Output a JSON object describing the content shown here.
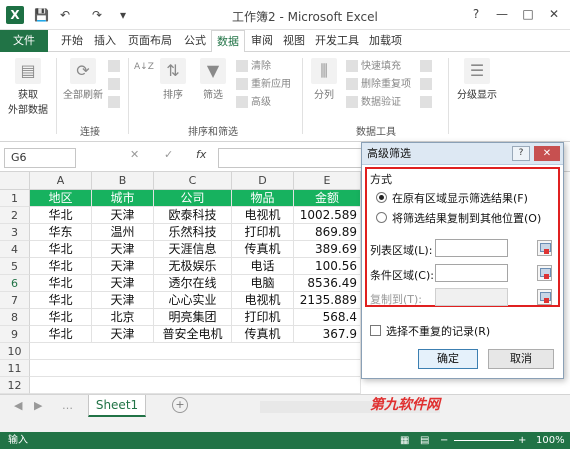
{
  "window": {
    "title": "工作簿2 - Microsoft Excel",
    "logo": "X",
    "help": "?",
    "min": "—",
    "max": "□",
    "close": "✕"
  },
  "quick_access": {
    "save_icon": "💾",
    "undo": "↶",
    "redo": "↷",
    "more": "▾"
  },
  "tabs": [
    {
      "label": "文件"
    },
    {
      "label": "开始"
    },
    {
      "label": "插入"
    },
    {
      "label": "页面布局"
    },
    {
      "label": "公式"
    },
    {
      "label": "数据"
    },
    {
      "label": "审阅"
    },
    {
      "label": "视图"
    },
    {
      "label": "开发工具"
    },
    {
      "label": "加载项"
    }
  ],
  "ribbon": {
    "get_external": "获取\n外部数据",
    "refresh_all": "全部刷新",
    "connections_group": "连接",
    "sort_az": "A↓Z",
    "sort": "排序",
    "filter": "筛选",
    "clear": "清除",
    "reapply": "重新应用",
    "advanced": "高级",
    "sort_filter_group": "排序和筛选",
    "split": "分列",
    "flash_fill": "快速填充",
    "remove_dup": "删除重复项",
    "validation": "数据验证",
    "data_tools_group": "数据工具",
    "outline": "分级显示"
  },
  "formula_bar": {
    "name_box": "G6",
    "cancel": "✕",
    "enter": "✓",
    "fx": "fx"
  },
  "columns": [
    "A",
    "B",
    "C",
    "D",
    "E"
  ],
  "rows": [
    "1",
    "2",
    "3",
    "4",
    "5",
    "6",
    "7",
    "8",
    "9",
    "10",
    "11",
    "12"
  ],
  "table": {
    "header": [
      "地区",
      "城市",
      "公司",
      "物品",
      "金额"
    ],
    "data": [
      [
        "华北",
        "天津",
        "欧泰科技",
        "电视机",
        "1002.589"
      ],
      [
        "华东",
        "温州",
        "乐然科技",
        "打印机",
        "869.89"
      ],
      [
        "华北",
        "天津",
        "天涯信息",
        "传真机",
        "389.69"
      ],
      [
        "华北",
        "天津",
        "无极娱乐",
        "电话",
        "100.56"
      ],
      [
        "华北",
        "天津",
        "透尔在线",
        "电脑",
        "8536.49"
      ],
      [
        "华北",
        "天津",
        "心心实业",
        "电视机",
        "2135.889"
      ],
      [
        "华北",
        "北京",
        "明亮集团",
        "打印机",
        "568.4"
      ],
      [
        "华北",
        "天津",
        "普安全电机",
        "传真机",
        "367.9"
      ]
    ]
  },
  "sheet_tab": "Sheet1",
  "status": {
    "mode": "输入",
    "zoom": "100%"
  },
  "dialog": {
    "title": "高级筛选",
    "method": "方式",
    "opt1": "在原有区域显示筛选结果(F)",
    "opt2": "将筛选结果复制到其他位置(O)",
    "list_range": "列表区域(L):",
    "criteria_range": "条件区域(C):",
    "copy_to": "复制到(T):",
    "unique": "选择不重复的记录(R)",
    "ok": "确定",
    "cancel": "取消",
    "help": "?",
    "close": "✕"
  },
  "watermark": "第九软件网"
}
